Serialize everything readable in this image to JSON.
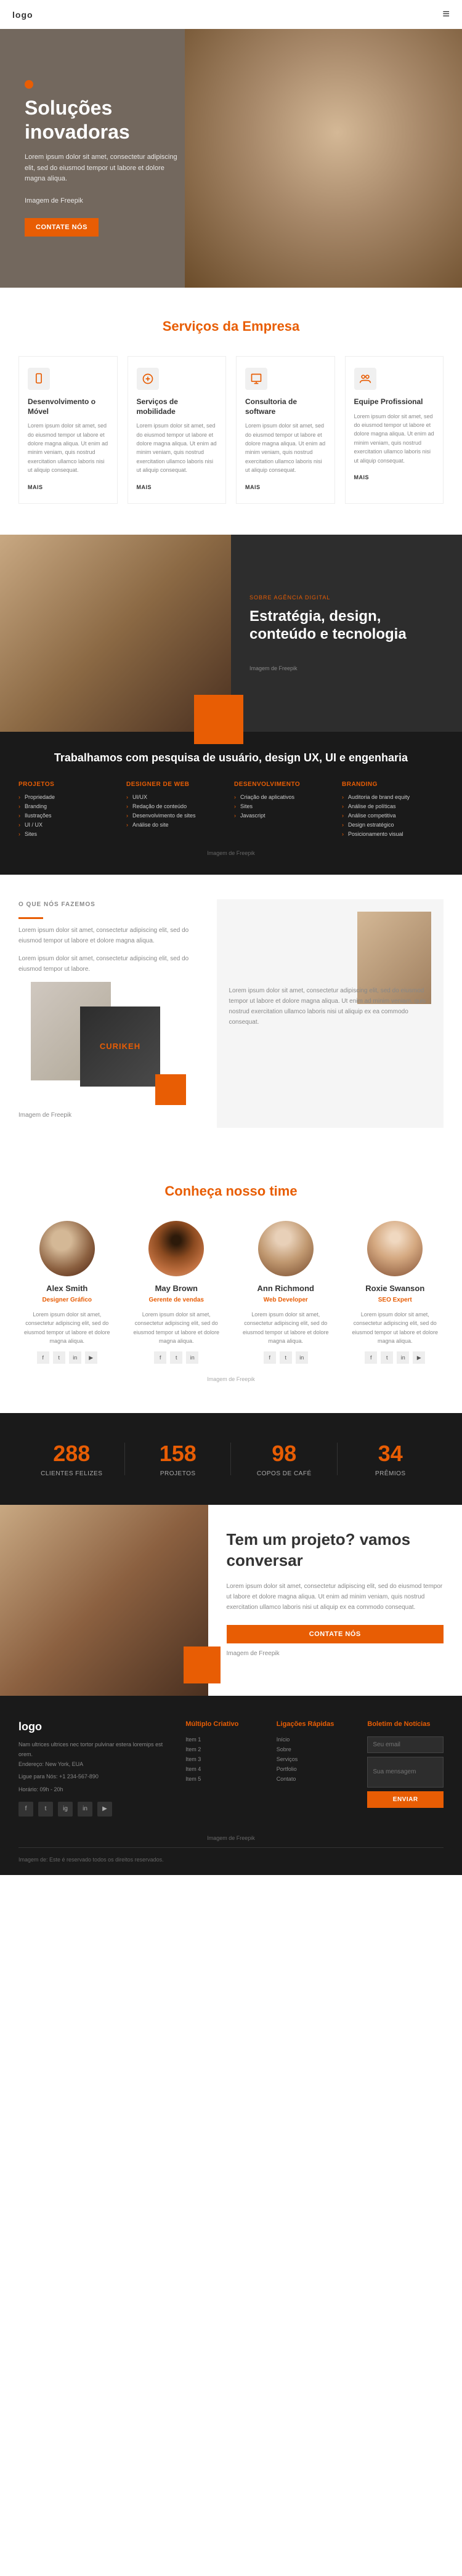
{
  "nav": {
    "logo": "logo",
    "menu_icon": "≡"
  },
  "hero": {
    "title": "Soluções inovadoras",
    "body": "Lorem ipsum dolor sit amet, consectetur adipiscing elit, sed do eiusmod tempor ut labore et dolore magna aliqua.",
    "image_credit": "Imagem de Freepik",
    "cta_label": "CONTATE NÓS",
    "dot_color": "#e85d04"
  },
  "services": {
    "section_title": "Serviços da Empresa",
    "items": [
      {
        "title": "Desenvolvimento o Móvel",
        "body": "Lorem ipsum dolor sit amet, sed do eiusmod tempor ut labore et dolore magna aliqua. Ut enim ad minim veniam, quis nostrud exercitation ullamco laboris nisi ut aliquip consequat.",
        "link": "MAIS",
        "icon": "mobile"
      },
      {
        "title": "Serviços de mobilidade",
        "body": "Lorem ipsum dolor sit amet, sed do eiusmod tempor ut labore et dolore magna aliqua. Ut enim ad minim veniam, quis nostrud exercitation ullamco laboris nisi ut aliquip consequat.",
        "link": "MAIS",
        "icon": "service"
      },
      {
        "title": "Consultoria de software",
        "body": "Lorem ipsum dolor sit amet, sed do eiusmod tempor ut labore et dolore magna aliqua. Ut enim ad minim veniam, quis nostrud exercitation ullamco laboris nisi ut aliquip consequat.",
        "link": "MAIS",
        "icon": "consulting"
      },
      {
        "title": "Equipe Profissional",
        "body": "Lorem ipsum dolor sit amet, sed do eiusmod tempor ut labore et dolore magna aliqua. Ut enim ad minim veniam, quis nostrud exercitation ullamco laboris nisi ut aliquip consequat.",
        "link": "MAIS",
        "icon": "team"
      }
    ]
  },
  "about": {
    "label": "SOBRE AGÊNCIA DIGITAL",
    "title": "Estratégia, design, conteúdo e tecnologia",
    "image_credit": "Imagem de Freepik"
  },
  "research": {
    "title": "Trabalhamos com pesquisa de usuário, design UX, UI e engenharia",
    "columns": [
      {
        "heading": "Projetos",
        "items": [
          "Propriedade",
          "Branding",
          "Ilustrações",
          "UI / UX",
          "Sites"
        ]
      },
      {
        "heading": "Designer de Web",
        "items": [
          "UI/UX",
          "Redação de conteúdo",
          "Desenvolvimento de sites",
          "Análise do site"
        ]
      },
      {
        "heading": "Desenvolvimento",
        "items": [
          "Criação de aplicativos",
          "Sites",
          "Javascript"
        ]
      },
      {
        "heading": "Branding",
        "items": [
          "Auditoria de brand equity",
          "Análise de políticas",
          "Análise competitiva",
          "Design estratégico",
          "Posicionamento visual"
        ]
      }
    ],
    "image_credit": "Imagem de Freepik"
  },
  "what_we_do": {
    "label": "O QUE NÓS FAZEMOS",
    "body1": "Lorem ipsum dolor sit amet, consectetur adipiscing elit, sed do eiusmod tempor ut labore et dolore magna aliqua.",
    "body2": "Lorem ipsum dolor sit amet, consectetur adipiscing elit, sed do eiusmod tempor ut labore.",
    "brand_name": "CURIKEH",
    "image_credit": "Imagem de Freepik",
    "right_body": "Lorem ipsum dolor sit amet, consectetur adipiscing elit, sed do eiusmod tempor ut labore et dolore magna aliqua. Ut enim ad minim veniam, quis nostrud exercitation ullamco laboris nisi ut aliquip ex ea commodo consequat."
  },
  "team": {
    "section_title": "Conheça nosso time",
    "image_credit": "Imagem de Freepik",
    "members": [
      {
        "name": "Alex Smith",
        "role": "Designer Gráfico",
        "bio": "Lorem ipsum dolor sit amet, consectetur adipiscing elit, sed do eiusmod tempor ut labore et dolore magna aliqua.",
        "socials": [
          "f",
          "tw",
          "in",
          "yt"
        ]
      },
      {
        "name": "May Brown",
        "role": "Gerente de vendas",
        "bio": "Lorem ipsum dolor sit amet, consectetur adipiscing elit, sed do eiusmod tempor ut labore et dolore magna aliqua.",
        "socials": [
          "f",
          "tw",
          "in"
        ]
      },
      {
        "name": "Ann Richmond",
        "role": "Web Developer",
        "bio": "Lorem ipsum dolor sit amet, consectetur adipiscing elit, sed do eiusmod tempor ut labore et dolore magna aliqua.",
        "socials": [
          "f",
          "tw",
          "in"
        ]
      },
      {
        "name": "Roxie Swanson",
        "role": "SEO Expert",
        "bio": "Lorem ipsum dolor sit amet, consectetur adipiscing elit, sed do eiusmod tempor ut labore et dolore magna aliqua.",
        "socials": [
          "f",
          "tw",
          "in",
          "yt"
        ]
      }
    ]
  },
  "stats": {
    "items": [
      {
        "number": "288",
        "label": "CLIENTES FELIZES"
      },
      {
        "number": "158",
        "label": "PROJETOS"
      },
      {
        "number": "98",
        "label": "COPOS DE CAFÉ"
      },
      {
        "number": "34",
        "label": "PRÊMIOS"
      }
    ]
  },
  "cta": {
    "title": "Tem um projeto? vamos conversar",
    "body": "Lorem ipsum dolor sit amet, consectetur adipiscing elit, sed do eiusmod tempor ut labore et dolore magna aliqua. Ut enim ad minim veniam, quis nostrud exercitation ullamco laboris nisi ut aliquip ex ea commodo consequat.",
    "button_label": "CONTATE NÓS",
    "image_credit": "Imagem de Freepik"
  },
  "footer": {
    "logo": "Nam ultrices ultrices nec tortor pulvinar estera loremips est orem.",
    "address_label": "Endereço:",
    "address": "New York, EUA",
    "phone_label": "Ligue para Nós:",
    "phone": "+1 234-567-890",
    "hours_label": "Horário:",
    "hours": "09h - 20h",
    "col2_title": "Múltiplo Criativo",
    "col2_items": [
      "Item 1",
      "Item 2",
      "Item 3",
      "Item 4",
      "Item 5"
    ],
    "col3_title": "Ligações Rápidas",
    "col3_items": [
      "Início",
      "Sobre",
      "Serviços",
      "Portfolio",
      "Contato"
    ],
    "col4_title": "Boletim de Notícias",
    "col4_placeholder_email": "Seu email",
    "col4_placeholder_msg": "Sua mensagem",
    "col4_button": "ENVIAR",
    "socials": [
      "f",
      "tw",
      "ig",
      "in",
      "yt"
    ],
    "copyright": "Imagem de: Este é reservado todos os direitos reservados.",
    "image_credit": "Imagem de Freepik"
  }
}
